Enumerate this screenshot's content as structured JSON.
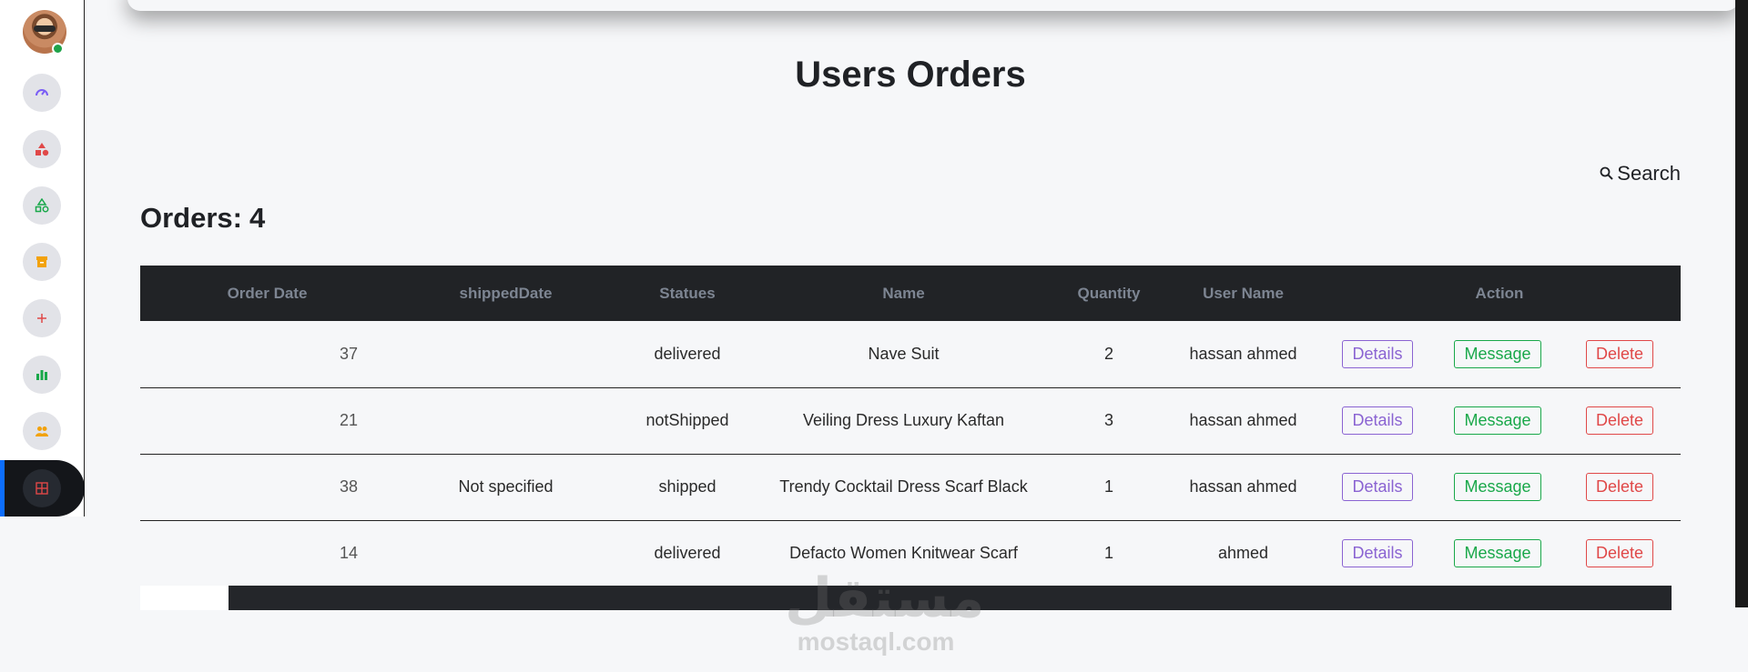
{
  "page": {
    "title": "Users Orders",
    "orders_label": "Orders:",
    "orders_count": "4"
  },
  "search": {
    "label": "Search"
  },
  "sidebar": {
    "items": [
      {
        "icon": "gauge-icon",
        "color": "#7b5ff5"
      },
      {
        "icon": "shapes-icon",
        "color": "#e04848"
      },
      {
        "icon": "categories-icon",
        "color": "#19a84a"
      },
      {
        "icon": "archive-icon",
        "color": "#f2a20c"
      },
      {
        "icon": "plus-icon",
        "color": "#e04848"
      },
      {
        "icon": "chart-icon",
        "color": "#19a84a"
      },
      {
        "icon": "users-icon",
        "color": "#f2a20c"
      },
      {
        "icon": "grid-icon",
        "color": "#e04848"
      }
    ]
  },
  "table": {
    "columns": [
      "Order Date",
      "shippedDate",
      "Statues",
      "Name",
      "Quantity",
      "User Name",
      "Action"
    ],
    "rows": [
      {
        "order_date": "37",
        "shipped_date": "",
        "status": "delivered",
        "name": "Nave Suit",
        "quantity": "2",
        "user_name": "hassan ahmed"
      },
      {
        "order_date": "21",
        "shipped_date": "",
        "status": "notShipped",
        "name": "Veiling Dress Luxury Kaftan",
        "quantity": "3",
        "user_name": "hassan ahmed"
      },
      {
        "order_date": "38",
        "shipped_date": "Not specified",
        "status": "shipped",
        "name": "Trendy Cocktail Dress Scarf Black",
        "quantity": "1",
        "user_name": "hassan ahmed"
      },
      {
        "order_date": "14",
        "shipped_date": "",
        "status": "delivered",
        "name": "Defacto Women Knitwear Scarf",
        "quantity": "1",
        "user_name": "ahmed"
      }
    ],
    "actions": {
      "details": "Details",
      "message": "Message",
      "delete": "Delete"
    }
  },
  "watermark": {
    "arabic": "مستقل",
    "latin": "mostaql.com"
  }
}
